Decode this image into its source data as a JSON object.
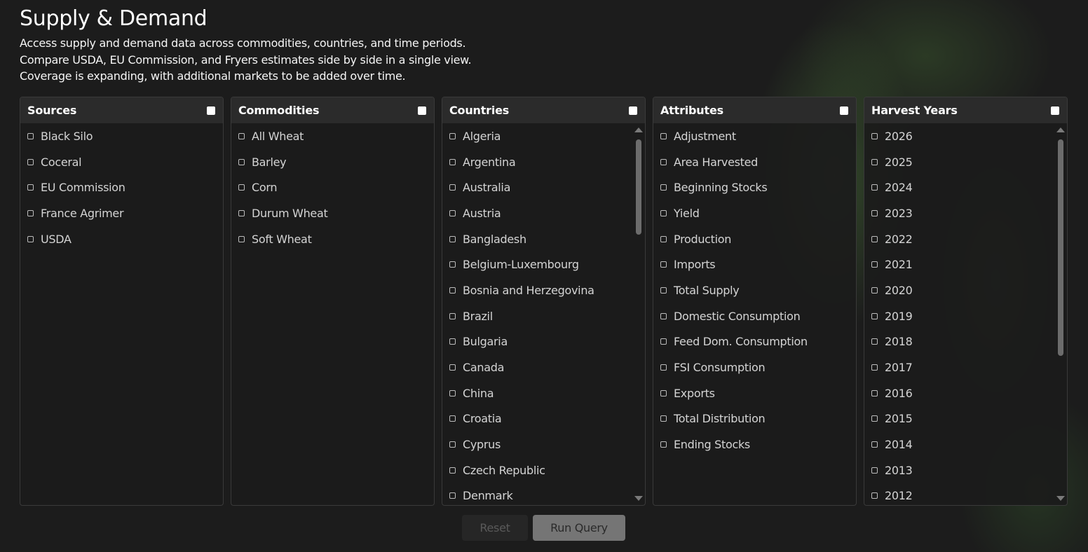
{
  "page": {
    "title": "Supply & Demand",
    "description": [
      "Access supply and demand data across commodities, countries, and time periods.",
      "Compare USDA, EU Commission, and Fryers estimates side by side in a single view.",
      "Coverage is expanding, with additional markets to be added over time."
    ]
  },
  "panels": {
    "sources": {
      "title": "Sources",
      "items": [
        "Black Silo",
        "Coceral",
        "EU Commission",
        "France Agrimer",
        "USDA"
      ]
    },
    "commodities": {
      "title": "Commodities",
      "items": [
        "All Wheat",
        "Barley",
        "Corn",
        "Durum Wheat",
        "Soft Wheat"
      ]
    },
    "countries": {
      "title": "Countries",
      "items": [
        "Algeria",
        "Argentina",
        "Australia",
        "Austria",
        "Bangladesh",
        "Belgium-Luxembourg",
        "Bosnia and Herzegovina",
        "Brazil",
        "Bulgaria",
        "Canada",
        "China",
        "Croatia",
        "Cyprus",
        "Czech Republic",
        "Denmark"
      ]
    },
    "attributes": {
      "title": "Attributes",
      "items": [
        "Adjustment",
        "Area Harvested",
        "Beginning Stocks",
        "Yield",
        "Production",
        "Imports",
        "Total Supply",
        "Domestic Consumption",
        "Feed Dom. Consumption",
        "FSI Consumption",
        "Exports",
        "Total Distribution",
        "Ending Stocks"
      ]
    },
    "harvest_years": {
      "title": "Harvest Years",
      "items": [
        "2026",
        "2025",
        "2024",
        "2023",
        "2022",
        "2021",
        "2020",
        "2019",
        "2018",
        "2017",
        "2016",
        "2015",
        "2014",
        "2013",
        "2012"
      ]
    }
  },
  "actions": {
    "reset_label": "Reset",
    "run_label": "Run Query"
  },
  "colors": {
    "background": "#1c1c1c",
    "panel_header": "#2b2b2b",
    "run_button": "#757575",
    "accent_glow": "#50823c"
  }
}
